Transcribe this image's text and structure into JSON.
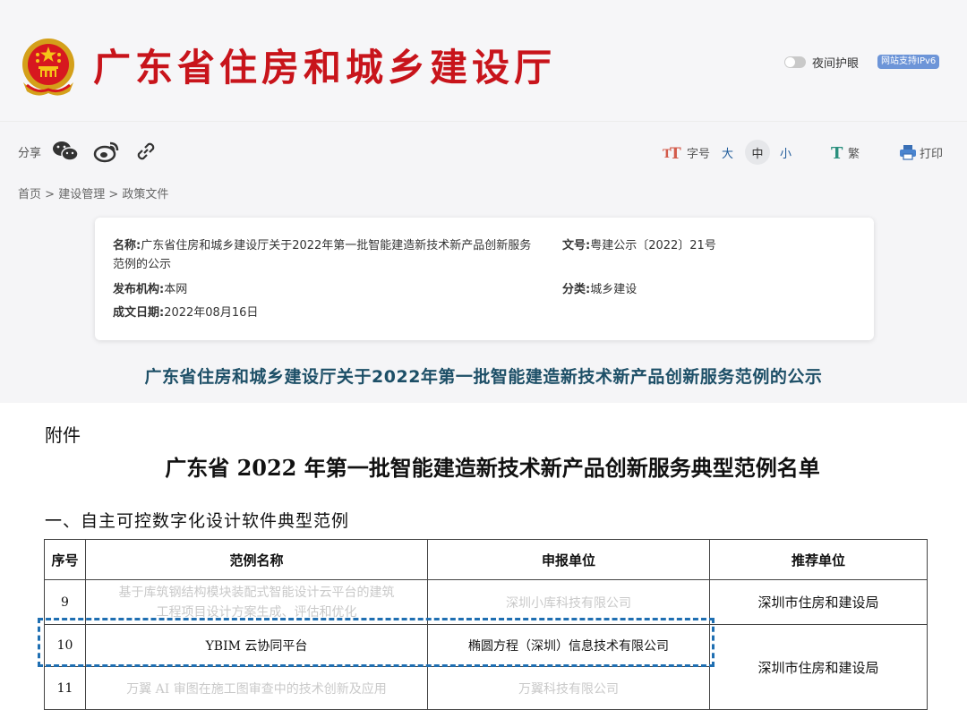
{
  "header": {
    "site_title": "广东省住房和城乡建设厅",
    "night_mode_label": "夜间护眼",
    "ipv6_badge": "网站支持IPv6"
  },
  "share": {
    "label": "分享",
    "icons": [
      "wechat-icon",
      "weibo-icon",
      "link-icon"
    ]
  },
  "toolbar": {
    "font_size_label": "字号",
    "font_large": "大",
    "font_medium": "中",
    "font_small": "小",
    "traditional": "繁",
    "print": "打印"
  },
  "breadcrumb": [
    "首页",
    "建设管理",
    "政策文件"
  ],
  "document_meta": {
    "name_label": "名称:",
    "name_value": "广东省住房和城乡建设厅关于2022年第一批智能建造新技术新产品创新服务范例的公示",
    "number_label": "文号:",
    "number_value": "粤建公示〔2022〕21号",
    "publisher_label": "发布机构:",
    "publisher_value": "本网",
    "category_label": "分类:",
    "category_value": "城乡建设",
    "date_label": "成文日期:",
    "date_value": "2022年08月16日"
  },
  "article_title": "广东省住房和城乡建设厅关于2022年第一批智能建造新技术新产品创新服务范例的公示",
  "attachment": {
    "label": "附件",
    "list_title": "广东省 2022 年第一批智能建造新技术新产品创新服务典型范例名单",
    "section_title": "一、自主可控数字化设计软件典型范例",
    "table": {
      "headers": [
        "序号",
        "范例名称",
        "申报单位",
        "推荐单位"
      ],
      "rows": [
        {
          "no": "9",
          "name_line1": "基于库筑钢结构模块装配式智能设计云平台的建筑",
          "name_line2": "工程项目设计方案生成、评估和优化",
          "unit": "深圳小库科技有限公司",
          "recommender": "深圳市住房和建设局"
        },
        {
          "no": "10",
          "name": "YBIM 云协同平台",
          "unit": "椭圆方程（深圳）信息技术有限公司",
          "recommender": "深圳市住房和建设局"
        },
        {
          "no": "11",
          "name": "万翼 AI 审图在施工图审查中的技术创新及应用",
          "unit": "万翼科技有限公司"
        }
      ]
    }
  },
  "colors": {
    "title_red": "#c8141b",
    "article_title": "#1d4f67",
    "highlight_blue": "#1f6fb2",
    "ipv6_badge": "#6d95d8"
  }
}
